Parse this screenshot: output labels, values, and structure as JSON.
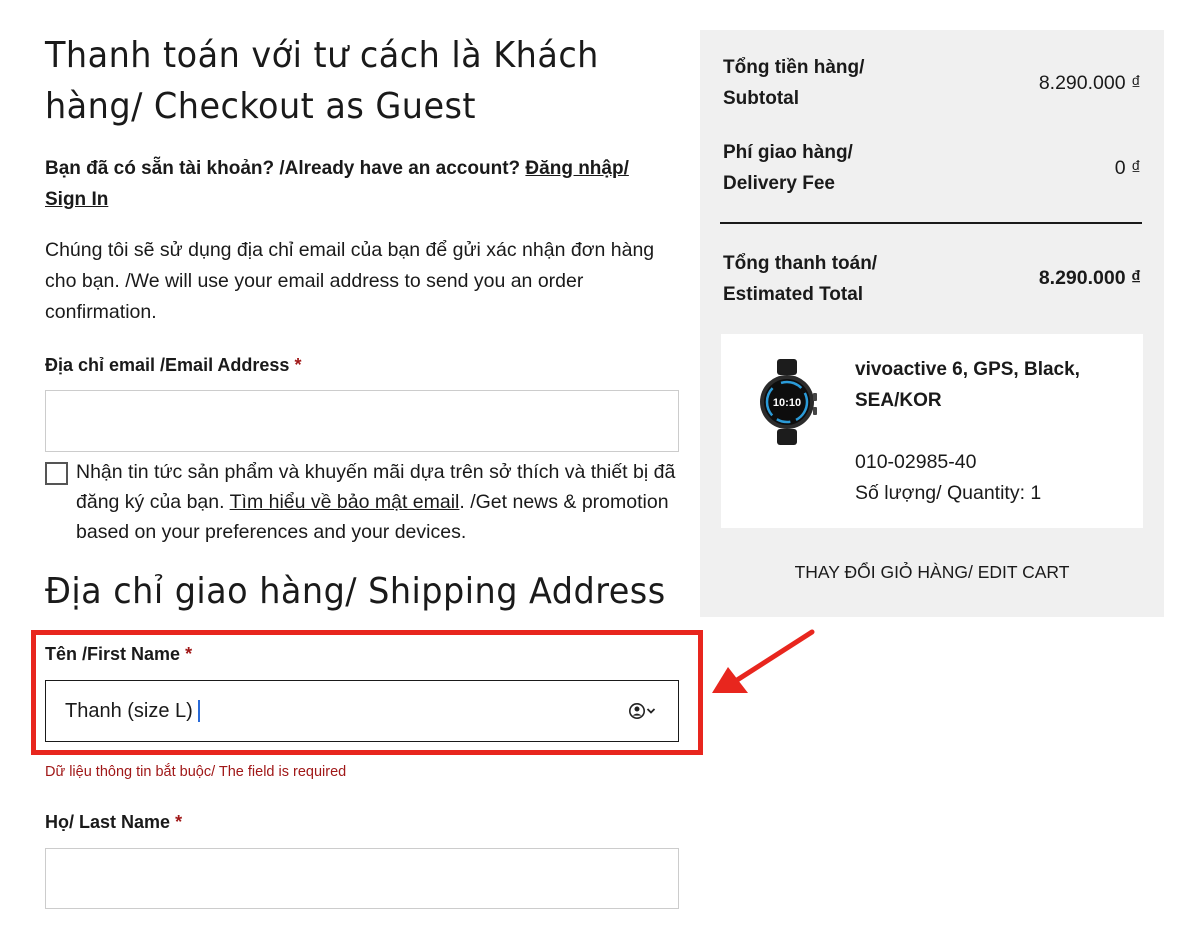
{
  "checkout": {
    "title": "Thanh toán với tư cách là Khách hàng/ Checkout as Guest",
    "account_prompt": "Bạn đã có sẵn tài khoản? /Already have an account?",
    "sign_in_link": "Đăng nhập/ Sign In",
    "email_info": "Chúng tôi sẽ sử dụng địa chỉ email của bạn để gửi xác nhận đơn hàng cho bạn. /We will use your email address to send you an order confirmation.",
    "email_label": "Địa chỉ email /Email Address",
    "email_value": "",
    "required_mark": "*",
    "newsletter_text_before": "Nhận tin tức sản phẩm và khuyến mãi dựa trên sở thích và thiết bị đã đăng ký của bạn.",
    "newsletter_link": "Tìm hiểu về bảo mật email",
    "newsletter_text_after": ". /Get news & promotion based on your preferences and your devices.",
    "newsletter_checked": false
  },
  "shipping": {
    "title": "Địa chỉ giao hàng/ Shipping Address",
    "first_name_label": "Tên /First Name",
    "first_name_value": "Thanh (size L)",
    "first_name_error": "Dữ liệu thông tin bắt buộc/ The field is required",
    "last_name_label": "Họ/ Last Name",
    "last_name_value": ""
  },
  "summary": {
    "subtotal_label_1": "Tổng tiền hàng/",
    "subtotal_label_2": "Subtotal",
    "subtotal_value": "8.290.000 ₫",
    "delivery_label_1": "Phí giao hàng/",
    "delivery_label_2": "Delivery Fee",
    "delivery_value": "0 ₫",
    "total_label_1": "Tổng thanh toán/",
    "total_label_2": "Estimated Total",
    "total_value": "8.290.000 ₫",
    "product_name": "vivoactive 6, GPS, Black, SEA/KOR",
    "product_sku": "010-02985-40",
    "product_quantity": "Số lượng/ Quantity: 1",
    "watch_time": "10:10",
    "edit_cart": "THAY ĐỔI GIỎ HÀNG/ EDIT CART"
  },
  "colors": {
    "highlight": "#e8261e",
    "required": "#a01818",
    "summary_bg": "#f0f0f0"
  }
}
